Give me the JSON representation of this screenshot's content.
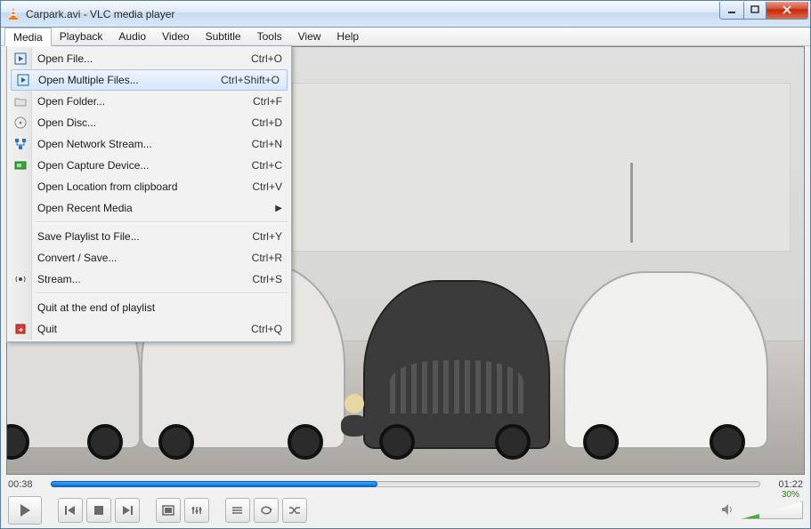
{
  "title": "Carpark.avi - VLC media player",
  "menubar": [
    "Media",
    "Playback",
    "Audio",
    "Video",
    "Subtitle",
    "Tools",
    "View",
    "Help"
  ],
  "activeMenuIndex": 0,
  "mediaMenu": {
    "items": [
      {
        "icon": "play-file",
        "label": "Open File...",
        "shortcut": "Ctrl+O"
      },
      {
        "icon": "play-file",
        "label": "Open Multiple Files...",
        "shortcut": "Ctrl+Shift+O",
        "highlight": true
      },
      {
        "icon": "folder",
        "label": "Open Folder...",
        "shortcut": "Ctrl+F"
      },
      {
        "icon": "disc",
        "label": "Open Disc...",
        "shortcut": "Ctrl+D"
      },
      {
        "icon": "network",
        "label": "Open Network Stream...",
        "shortcut": "Ctrl+N"
      },
      {
        "icon": "capture",
        "label": "Open Capture Device...",
        "shortcut": "Ctrl+C"
      },
      {
        "icon": "",
        "label": "Open Location from clipboard",
        "shortcut": "Ctrl+V"
      },
      {
        "icon": "",
        "label": "Open Recent Media",
        "shortcut": "",
        "submenu": true
      },
      {
        "sep": true
      },
      {
        "icon": "",
        "label": "Save Playlist to File...",
        "shortcut": "Ctrl+Y"
      },
      {
        "icon": "",
        "label": "Convert / Save...",
        "shortcut": "Ctrl+R"
      },
      {
        "icon": "stream",
        "label": "Stream...",
        "shortcut": "Ctrl+S"
      },
      {
        "sep": true
      },
      {
        "icon": "",
        "label": "Quit at the end of playlist",
        "shortcut": ""
      },
      {
        "icon": "quit",
        "label": "Quit",
        "shortcut": "Ctrl+Q"
      }
    ]
  },
  "playback": {
    "elapsed": "00:38",
    "total": "01:22",
    "progressPercent": 46
  },
  "volume": {
    "percent": 30,
    "label": "30%"
  },
  "colors": {
    "seekBlue": "#0a6bd6",
    "volumeGreen": "#4aa833",
    "closeRed": "#c32707"
  }
}
